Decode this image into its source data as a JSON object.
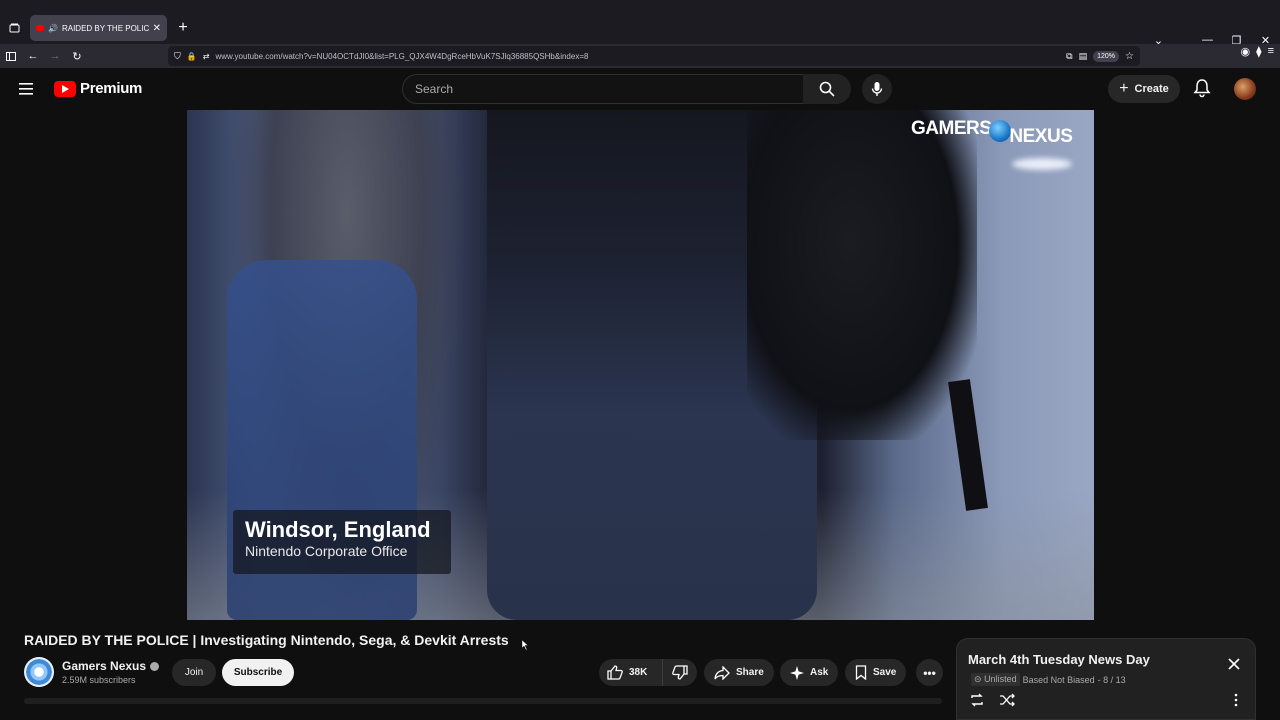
{
  "browser": {
    "tab_title": "RAIDED BY THE POLICE | In",
    "url": "www.youtube.com/watch?v=NU04OCTdJI0&list=PLG_QJX4W4DgRceHbVuK7SJlq36885QSHb&index=8",
    "zoom": "120%"
  },
  "header": {
    "logo_text": "Premium",
    "search_placeholder": "Search",
    "create_label": "Create"
  },
  "video": {
    "brand_part1": "GAMERS",
    "brand_part2": "NEXUS",
    "location": "Windsor, England",
    "location_sub": "Nintendo Corporate Office"
  },
  "info": {
    "title": "RAIDED BY THE POLICE | Investigating Nintendo, Sega, & Devkit Arrests",
    "channel": "Gamers Nexus",
    "subscribers": "2.59M subscribers",
    "join_label": "Join",
    "subscribe_label": "Subscribe",
    "likes": "38K",
    "share_label": "Share",
    "ask_label": "Ask",
    "save_label": "Save",
    "more_label": "•••"
  },
  "playlist": {
    "title": "March 4th Tuesday News Day",
    "visibility": "Unlisted",
    "owner": "Based Not Biased",
    "position": "- 8 / 13"
  },
  "colors": {
    "background": "#0f0f0f",
    "brand_red": "#ff0000",
    "pill": "#272727"
  }
}
